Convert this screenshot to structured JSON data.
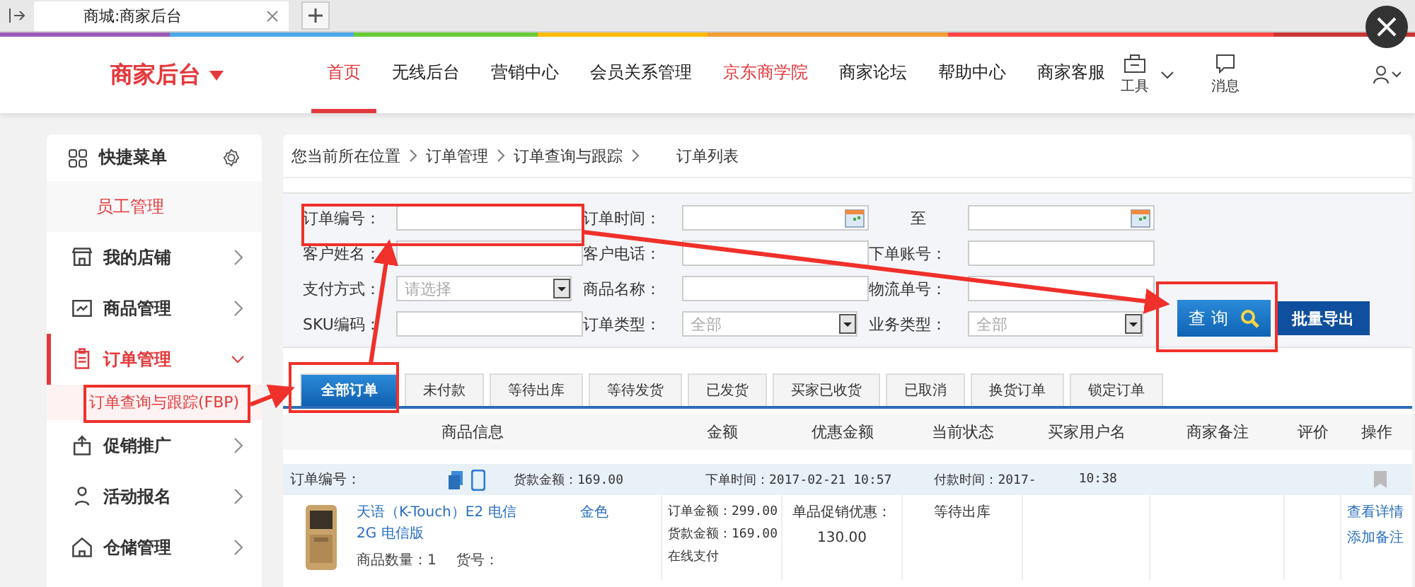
{
  "browser": {
    "tab_title": "商城:商家后台"
  },
  "header": {
    "logo": "商家后台",
    "nav": [
      {
        "label": "首页",
        "selected": true,
        "emphasized": false
      },
      {
        "label": "无线后台",
        "selected": false,
        "emphasized": false
      },
      {
        "label": "营销中心",
        "selected": false,
        "emphasized": false
      },
      {
        "label": "会员关系管理",
        "selected": false,
        "emphasized": false
      },
      {
        "label": "京东商学院",
        "selected": false,
        "emphasized": true
      },
      {
        "label": "商家论坛",
        "selected": false,
        "emphasized": false
      },
      {
        "label": "帮助中心",
        "selected": false,
        "emphasized": false
      },
      {
        "label": "商家客服",
        "selected": false,
        "emphasized": false
      }
    ],
    "tools": [
      "工具",
      "消息"
    ]
  },
  "sidebar": {
    "quick_menu": "快捷菜单",
    "shortcuts": [
      "员工管理"
    ],
    "items": [
      {
        "label": "我的店铺",
        "expanded": false
      },
      {
        "label": "商品管理",
        "expanded": false
      },
      {
        "label": "订单管理",
        "expanded": true,
        "children": [
          {
            "label": "订单查询与跟踪(FBP)",
            "selected": true
          }
        ]
      },
      {
        "label": "促销推广",
        "expanded": false
      },
      {
        "label": "活动报名",
        "expanded": false
      },
      {
        "label": "仓储管理",
        "expanded": false
      }
    ]
  },
  "breadcrumb": [
    "您当前所在位置",
    "订单管理",
    "订单查询与跟踪",
    "订单列表"
  ],
  "form": {
    "rows": [
      [
        {
          "label": "订单编号：",
          "kind": "text"
        },
        {
          "label": "订单时间：",
          "kind": "date"
        },
        {
          "label": "至",
          "kind": "date"
        }
      ],
      [
        {
          "label": "客户姓名：",
          "kind": "text"
        },
        {
          "label": "客户电话：",
          "kind": "text"
        },
        {
          "label": "下单账号：",
          "kind": "text"
        }
      ],
      [
        {
          "label": "支付方式：",
          "kind": "select",
          "placeholder": "请选择"
        },
        {
          "label": "商品名称：",
          "kind": "text"
        },
        {
          "label": "物流单号：",
          "kind": "text"
        }
      ],
      [
        {
          "label": "SKU编码：",
          "kind": "text"
        },
        {
          "label": "订单类型：",
          "kind": "select",
          "value": "全部"
        },
        {
          "label": "业务类型：",
          "kind": "select",
          "value": "全部"
        }
      ]
    ],
    "search_button": "查 询",
    "export_button": "批量导出"
  },
  "tabs": [
    {
      "label": "全部订单",
      "selected": true
    },
    {
      "label": "未付款",
      "selected": false
    },
    {
      "label": "等待出库",
      "selected": false
    },
    {
      "label": "等待发货",
      "selected": false
    },
    {
      "label": "已发货",
      "selected": false
    },
    {
      "label": "买家已收货",
      "selected": false
    },
    {
      "label": "已取消",
      "selected": false
    },
    {
      "label": "换货订单",
      "selected": false
    },
    {
      "label": "锁定订单",
      "selected": false
    }
  ],
  "table": {
    "columns": [
      "商品信息",
      "金额",
      "优惠金额",
      "当前状态",
      "买家用户名",
      "商家备注",
      "评价",
      "操作"
    ],
    "order": {
      "number_label": "订单编号：",
      "goods_amount": "货款金额：169.00",
      "order_time": "下单时间：2017-02-21 10:57",
      "pay_time": "付款时间：2017-",
      "pay_time_end": "10:38",
      "item": {
        "title": "天语（K-Touch）E2 电信2G 电信版",
        "variant": "金色",
        "quantity": "商品数量：1",
        "sku": "货号：",
        "amounts": [
          "订单金额：299.00",
          "货款金额：169.00",
          "在线支付"
        ],
        "promo_label": "单品促销优惠：",
        "promo_value": "130.00",
        "status": "等待出库",
        "actions": [
          "查看详情",
          "添加备注"
        ]
      }
    }
  }
}
